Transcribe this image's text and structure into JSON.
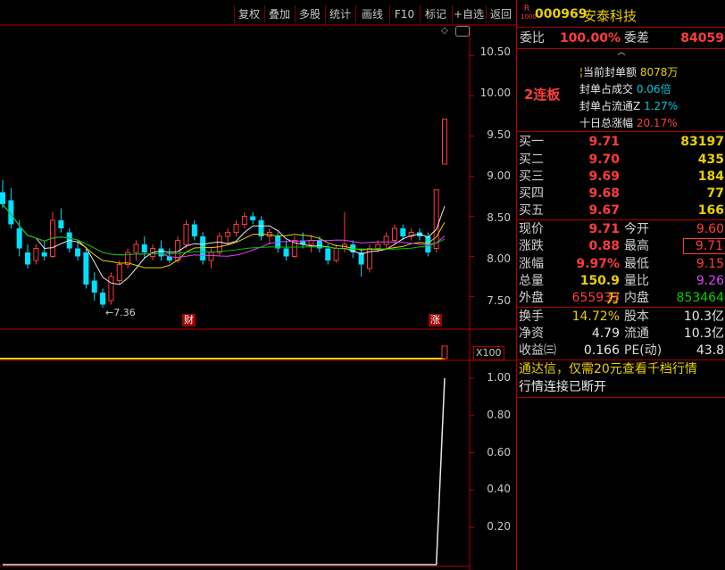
{
  "toolbar": {
    "buttons": [
      "复权",
      "叠加",
      "多股",
      "统计",
      "画线",
      "F10",
      "标记",
      "+自选",
      "返回"
    ]
  },
  "price_axis": {
    "ticks": [
      "10.50",
      "10.00",
      "9.50",
      "9.00",
      "8.50",
      "8.00",
      "7.50"
    ]
  },
  "volume_panel": {
    "scale_label": "X100"
  },
  "indicator_axis": {
    "ticks": [
      "1.00",
      "0.80",
      "0.60",
      "0.40",
      "0.20"
    ]
  },
  "annotations": {
    "low_label": "7.36",
    "fin_marker": "财",
    "zhang_marker": "涨"
  },
  "stock": {
    "r_mark": "R",
    "code": "000969",
    "name": "安泰科技"
  },
  "weibi": {
    "label": "委比",
    "value": "100.00%",
    "diff_label": "委差",
    "diff_value": "84059"
  },
  "limit_info": {
    "streak": "2连板",
    "rows": [
      {
        "label": "当前封单额",
        "value": "8078万"
      },
      {
        "label": "封单占成交",
        "value": "0.06倍"
      },
      {
        "label": "封单占流通Z",
        "value": "1.27%"
      },
      {
        "label": "十日总涨幅",
        "value": "20.17%"
      }
    ]
  },
  "bids": [
    {
      "label": "买一",
      "price": "9.71",
      "vol": "83197"
    },
    {
      "label": "买二",
      "price": "9.70",
      "vol": "435"
    },
    {
      "label": "买三",
      "price": "9.69",
      "vol": "184"
    },
    {
      "label": "买四",
      "price": "9.68",
      "vol": "77"
    },
    {
      "label": "买五",
      "price": "9.67",
      "vol": "166"
    }
  ],
  "quote": {
    "xianjia_l": "现价",
    "xianjia": "9.71",
    "jinkai_l": "今开",
    "jinkai": "9.60",
    "zhangdie_l": "涨跌",
    "zhangdie": "0.88",
    "zuigao_l": "最高",
    "zuigao": "9.71",
    "zhangfu_l": "涨幅",
    "zhangfu": "9.97%",
    "zuidi_l": "最低",
    "zuidi": "9.15",
    "zongliang_l": "总量",
    "zongliang": "150.9万",
    "liangbi_l": "量比",
    "liangbi": "9.26",
    "waipan_l": "外盘",
    "waipan": "655933",
    "neipan_l": "内盘",
    "neipan": "853464"
  },
  "fundamentals": {
    "huanshou_l": "换手",
    "huanshou": "14.72%",
    "guben_l": "股本",
    "guben": "10.3亿",
    "jingzi_l": "净资",
    "jingzi": "4.79",
    "liutong_l": "流通",
    "liutong": "10.3亿",
    "shouyi_l": "收益㈢",
    "shouyi": "0.166",
    "pe_l": "PE(动)",
    "pe": "43.8"
  },
  "notice": {
    "line1": "通达信，仅需20元查看千档行情",
    "line2": "行情连接已断开"
  },
  "colors": {
    "up": "#ff3c3c",
    "down": "#00e0ff",
    "ma5": "#e8e8e8",
    "ma10": "#e8d000",
    "ma20": "#e040ff",
    "ma60": "#00c000",
    "frame": "#b00000"
  },
  "chart_data": {
    "type": "candlestick",
    "ylim": [
      7.25,
      10.75
    ],
    "candles": [
      {
        "o": 8.8,
        "h": 8.95,
        "l": 8.6,
        "c": 8.65
      },
      {
        "o": 8.7,
        "h": 8.85,
        "l": 8.35,
        "c": 8.4
      },
      {
        "o": 8.35,
        "h": 8.45,
        "l": 8.0,
        "c": 8.1
      },
      {
        "o": 8.05,
        "h": 8.15,
        "l": 7.85,
        "c": 7.9
      },
      {
        "o": 7.95,
        "h": 8.15,
        "l": 7.9,
        "c": 8.1
      },
      {
        "o": 8.05,
        "h": 8.2,
        "l": 7.95,
        "c": 8.0
      },
      {
        "o": 8.0,
        "h": 8.55,
        "l": 7.98,
        "c": 8.45
      },
      {
        "o": 8.45,
        "h": 8.6,
        "l": 8.3,
        "c": 8.35
      },
      {
        "o": 8.3,
        "h": 8.35,
        "l": 8.05,
        "c": 8.1
      },
      {
        "o": 8.1,
        "h": 8.2,
        "l": 7.95,
        "c": 8.0
      },
      {
        "o": 8.05,
        "h": 8.1,
        "l": 7.6,
        "c": 7.65
      },
      {
        "o": 7.7,
        "h": 7.8,
        "l": 7.45,
        "c": 7.55
      },
      {
        "o": 7.55,
        "h": 7.6,
        "l": 7.36,
        "c": 7.4
      },
      {
        "o": 7.45,
        "h": 7.8,
        "l": 7.4,
        "c": 7.75
      },
      {
        "o": 7.7,
        "h": 7.95,
        "l": 7.65,
        "c": 7.9
      },
      {
        "o": 7.9,
        "h": 8.1,
        "l": 7.85,
        "c": 8.05
      },
      {
        "o": 8.05,
        "h": 8.2,
        "l": 7.95,
        "c": 8.15
      },
      {
        "o": 8.15,
        "h": 8.25,
        "l": 7.98,
        "c": 8.05
      },
      {
        "o": 8.0,
        "h": 8.15,
        "l": 7.95,
        "c": 8.1
      },
      {
        "o": 8.1,
        "h": 8.2,
        "l": 7.95,
        "c": 8.0
      },
      {
        "o": 8.0,
        "h": 8.1,
        "l": 7.92,
        "c": 7.95
      },
      {
        "o": 7.95,
        "h": 8.25,
        "l": 7.92,
        "c": 8.2
      },
      {
        "o": 8.15,
        "h": 8.45,
        "l": 8.1,
        "c": 8.4
      },
      {
        "o": 8.4,
        "h": 8.45,
        "l": 8.2,
        "c": 8.25
      },
      {
        "o": 8.25,
        "h": 8.3,
        "l": 7.9,
        "c": 7.95
      },
      {
        "o": 7.95,
        "h": 8.1,
        "l": 7.85,
        "c": 8.05
      },
      {
        "o": 8.05,
        "h": 8.3,
        "l": 8.0,
        "c": 8.25
      },
      {
        "o": 8.25,
        "h": 8.35,
        "l": 8.15,
        "c": 8.3
      },
      {
        "o": 8.3,
        "h": 8.45,
        "l": 8.25,
        "c": 8.4
      },
      {
        "o": 8.4,
        "h": 8.55,
        "l": 8.35,
        "c": 8.5
      },
      {
        "o": 8.5,
        "h": 8.55,
        "l": 8.4,
        "c": 8.45
      },
      {
        "o": 8.45,
        "h": 8.5,
        "l": 8.2,
        "c": 8.25
      },
      {
        "o": 8.25,
        "h": 8.35,
        "l": 8.15,
        "c": 8.3
      },
      {
        "o": 8.25,
        "h": 8.3,
        "l": 8.05,
        "c": 8.1
      },
      {
        "o": 8.1,
        "h": 8.2,
        "l": 7.95,
        "c": 8.0
      },
      {
        "o": 8.0,
        "h": 8.25,
        "l": 7.98,
        "c": 8.2
      },
      {
        "o": 8.2,
        "h": 8.3,
        "l": 8.1,
        "c": 8.15
      },
      {
        "o": 8.15,
        "h": 8.25,
        "l": 8.05,
        "c": 8.2
      },
      {
        "o": 8.2,
        "h": 8.25,
        "l": 8.05,
        "c": 8.1
      },
      {
        "o": 8.1,
        "h": 8.15,
        "l": 7.9,
        "c": 7.95
      },
      {
        "o": 7.95,
        "h": 8.15,
        "l": 7.92,
        "c": 8.1
      },
      {
        "o": 8.1,
        "h": 8.55,
        "l": 8.05,
        "c": 8.15
      },
      {
        "o": 8.15,
        "h": 8.2,
        "l": 7.98,
        "c": 8.05
      },
      {
        "o": 8.05,
        "h": 8.1,
        "l": 7.75,
        "c": 7.9
      },
      {
        "o": 7.85,
        "h": 8.15,
        "l": 7.8,
        "c": 8.1
      },
      {
        "o": 8.1,
        "h": 8.2,
        "l": 8.05,
        "c": 8.15
      },
      {
        "o": 8.15,
        "h": 8.3,
        "l": 8.1,
        "c": 8.25
      },
      {
        "o": 8.2,
        "h": 8.4,
        "l": 8.15,
        "c": 8.35
      },
      {
        "o": 8.35,
        "h": 8.4,
        "l": 8.2,
        "c": 8.25
      },
      {
        "o": 8.25,
        "h": 8.35,
        "l": 8.2,
        "c": 8.3
      },
      {
        "o": 8.3,
        "h": 8.35,
        "l": 8.2,
        "c": 8.25
      },
      {
        "o": 8.25,
        "h": 8.3,
        "l": 8.0,
        "c": 8.05
      },
      {
        "o": 8.1,
        "h": 8.83,
        "l": 8.05,
        "c": 8.83
      },
      {
        "o": 9.15,
        "h": 9.71,
        "l": 9.15,
        "c": 9.71
      }
    ],
    "indicator": {
      "values": [
        0,
        0,
        0,
        0,
        0,
        0,
        0,
        0,
        0,
        0,
        0,
        0,
        0,
        0,
        0,
        0,
        0,
        0,
        0,
        0,
        0,
        0,
        0,
        0,
        0,
        0,
        0,
        0,
        0,
        0,
        0,
        0,
        0,
        0,
        0,
        0,
        0,
        0,
        0,
        0,
        0,
        0,
        0,
        0,
        0,
        0,
        0,
        0,
        0,
        0,
        0,
        0,
        0,
        1
      ]
    }
  }
}
